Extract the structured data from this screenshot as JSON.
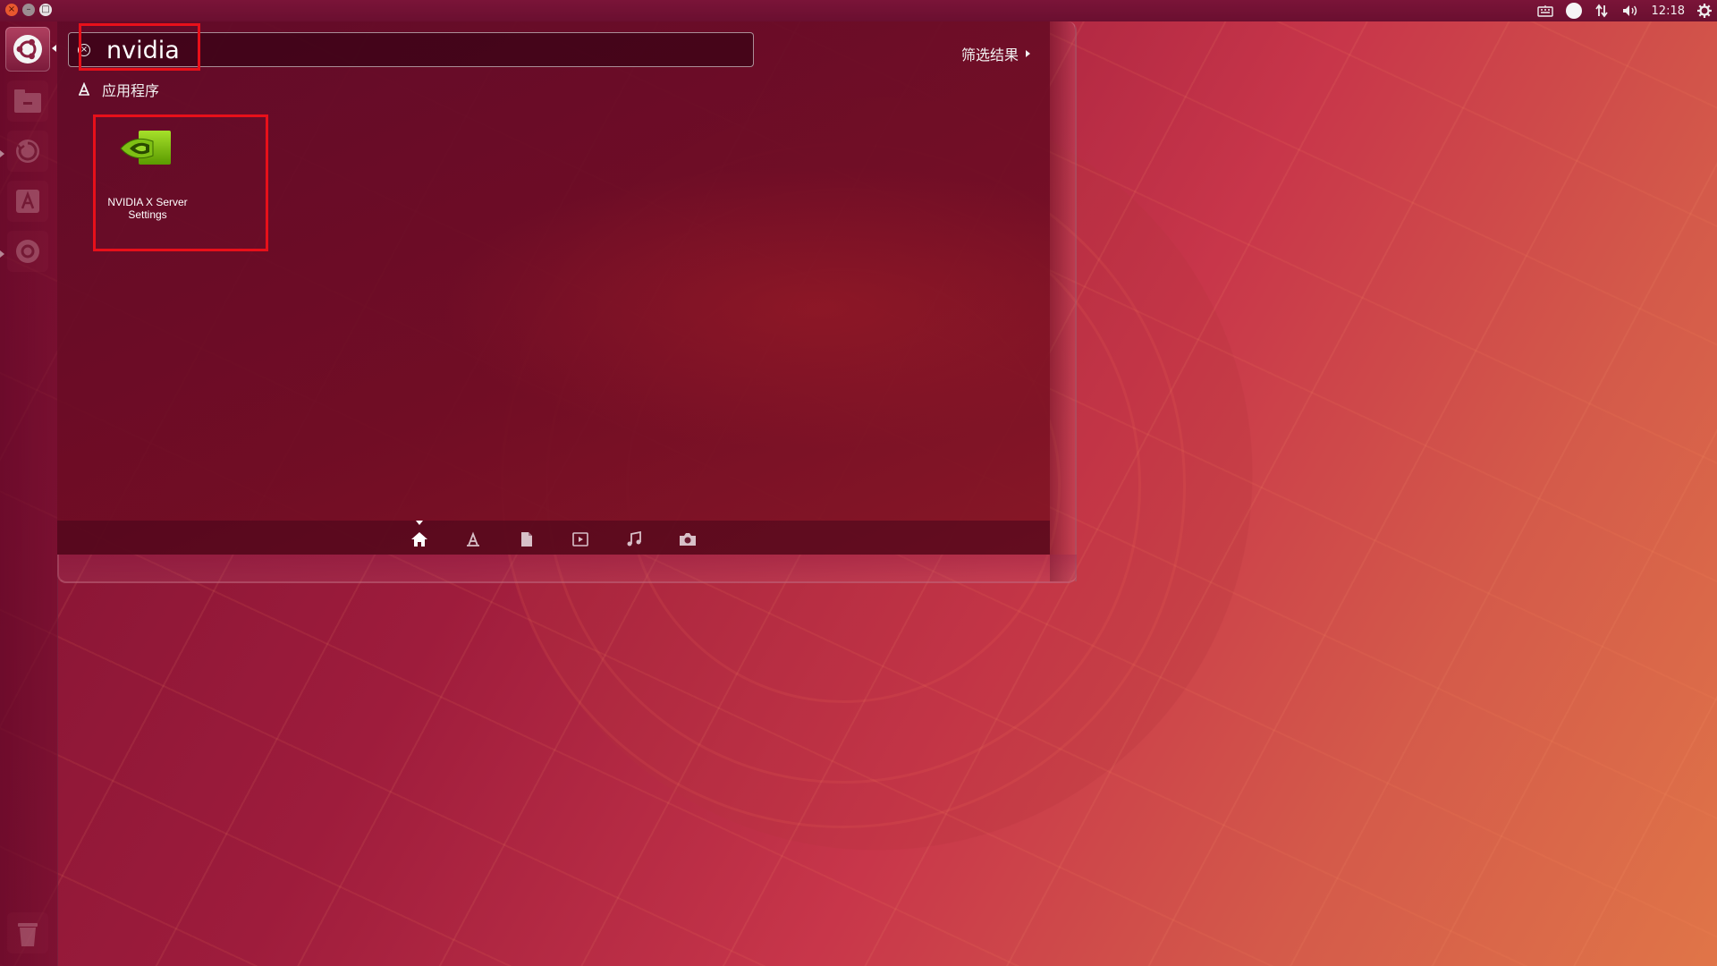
{
  "top_panel": {
    "window_controls": {
      "close": "×",
      "minimize": "–",
      "maximize": "□"
    },
    "indicators": {
      "keyboard_icon": "keyboard-icon",
      "network_icon": "network-arrows-icon",
      "volume_icon": "volume-icon",
      "clock": "12:18",
      "settings_icon": "gear-icon"
    }
  },
  "launcher": {
    "items": [
      "dash-home",
      "files",
      "updater",
      "software-center",
      "settings"
    ]
  },
  "dash": {
    "search": {
      "value": "nvidia",
      "clear_icon": "×"
    },
    "filter_label": "筛选结果",
    "category": {
      "label": "应用程序"
    },
    "results": [
      {
        "label": "NVIDIA X Server Settings"
      }
    ],
    "lenses": [
      "home",
      "applications",
      "files",
      "video",
      "music",
      "photos"
    ]
  },
  "colors": {
    "highlight_box": "#e8101a",
    "nvidia_green": "#76b900"
  }
}
